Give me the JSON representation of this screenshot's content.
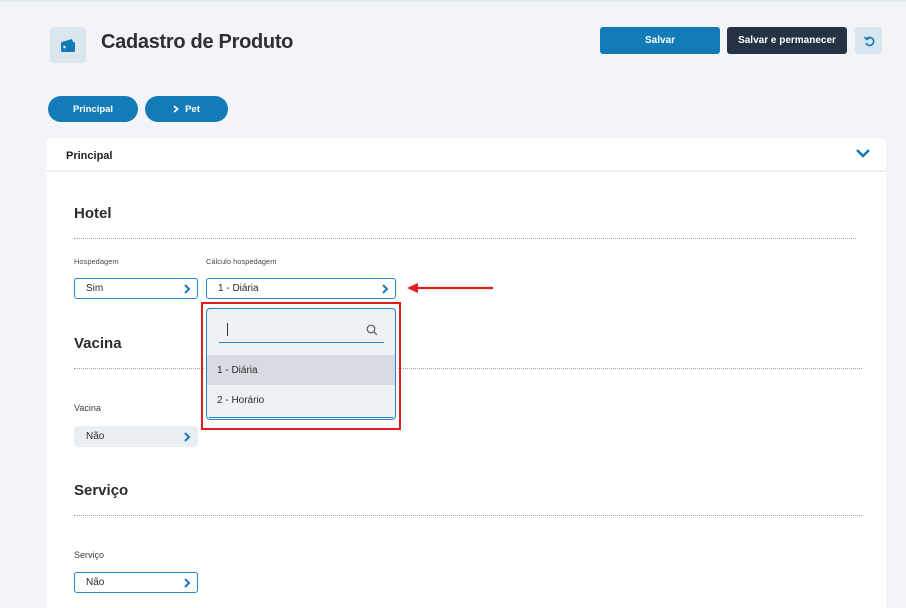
{
  "header": {
    "title": "Cadastro de Produto",
    "icon": "wallet-icon",
    "save_label": "Salvar",
    "save_stay_label": "Salvar e permanecer",
    "undo_icon": "undo-icon"
  },
  "breadcrumbs": [
    {
      "label": "Principal"
    },
    {
      "label": "Pet"
    }
  ],
  "card": {
    "title": "Principal"
  },
  "sections": {
    "hotel": {
      "title": "Hotel",
      "hospedagem_label": "Hospedagem",
      "hospedagem_value": "Sim",
      "calculo_label": "Cálculo hospedagem",
      "calculo_value": "1 - Diária"
    },
    "vacina": {
      "title": "Vacina",
      "field_label": "Vacina",
      "field_value": "Não"
    },
    "servico": {
      "title": "Serviço",
      "field_label": "Serviço",
      "field_value": "Não"
    }
  },
  "dropdown": {
    "search_value": "",
    "options": [
      {
        "label": "1 - Diária",
        "selected": true
      },
      {
        "label": "2 - Horário",
        "selected": false
      }
    ]
  },
  "colors": {
    "primary": "#137bb8",
    "dark": "#263345",
    "highlight": "#e01e1e"
  }
}
